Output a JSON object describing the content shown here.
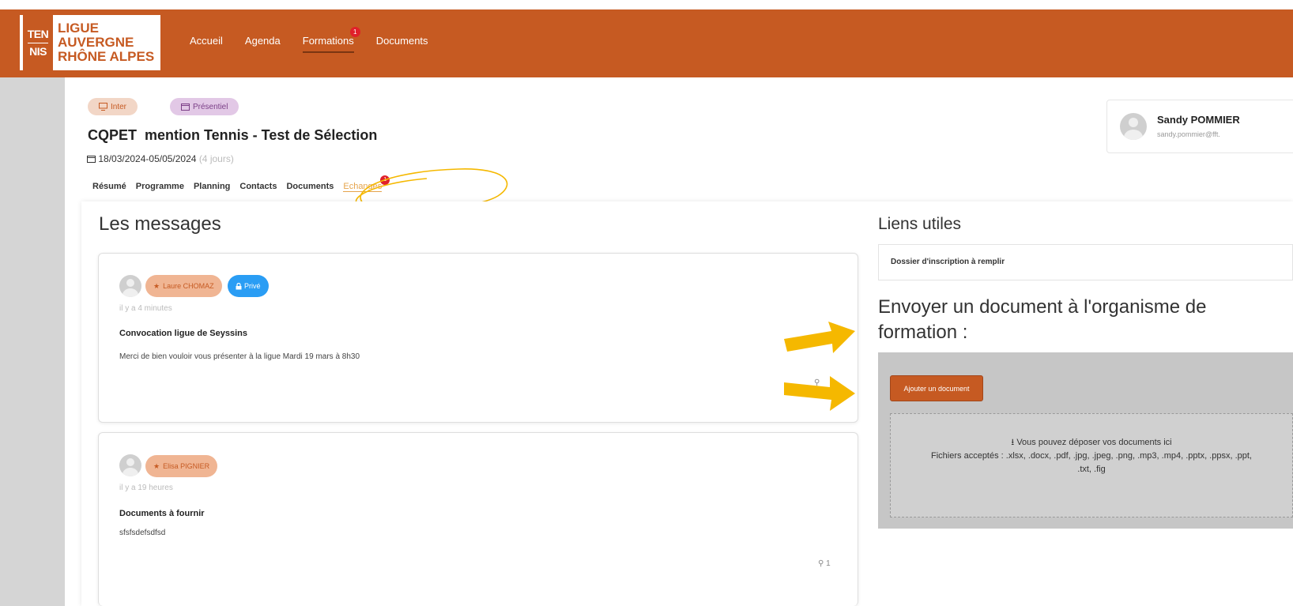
{
  "header": {
    "logo": {
      "mark_top": "TEN",
      "mark_bottom": "NIS",
      "line1": "LIGUE",
      "line2": "AUVERGNE",
      "line3": "RHÔNE ALPES"
    },
    "nav": [
      {
        "label": "Accueil"
      },
      {
        "label": "Agenda"
      },
      {
        "label": "Formations",
        "badge": "1",
        "active": true
      },
      {
        "label": "Documents"
      }
    ]
  },
  "course": {
    "tags": [
      {
        "label": "Inter",
        "icon": "monitor-icon"
      },
      {
        "label": "Présentiel",
        "icon": "calendar-icon"
      }
    ],
    "title": "CQPET  mention Tennis - Test de Sélection",
    "dates": "18/03/2024-05/05/2024",
    "duration": "(4 jours)",
    "tabs": [
      {
        "label": "Résumé"
      },
      {
        "label": "Programme"
      },
      {
        "label": "Planning"
      },
      {
        "label": "Contacts"
      },
      {
        "label": "Documents"
      },
      {
        "label": "Echanges",
        "badge": "1",
        "active": true
      }
    ]
  },
  "profile": {
    "name": "Sandy POMMIER",
    "email": "sandy.pommier@fft."
  },
  "messages": {
    "heading": "Les messages",
    "items": [
      {
        "author": "Laure CHOMAZ",
        "private_label": "Privé",
        "time": "il y a 4 minutes",
        "subject": "Convocation ligue de Seyssins",
        "body": "Merci de bien vouloir vous présenter à la ligue Mardi 19 mars à 8h30",
        "attachments": ""
      },
      {
        "author": "Elisa PIGNIER",
        "time": "il y a 19 heures",
        "subject": "Documents à fournir",
        "body": "sfsfsdefsdfsd",
        "attachments": "1"
      }
    ]
  },
  "liens": {
    "heading": "Liens utiles",
    "items": [
      {
        "label": "Dossier d'inscription à remplir"
      }
    ]
  },
  "upload": {
    "heading": "Envoyer un document à l'organisme de formation :",
    "add_button": "Ajouter un document",
    "drop_text": "Vous pouvez déposer vos documents ici",
    "accepted_text": "Fichiers acceptés : .xlsx, .docx, .pdf, .jpg, .jpeg, .png, .mp3, .mp4, .pptx, .ppsx, .ppt, .txt, .fig"
  },
  "colors": {
    "brand": "#c65a22",
    "tab_active": "#e5a44c",
    "private_badge": "#2a9df4",
    "annotation": "#f5b800"
  }
}
